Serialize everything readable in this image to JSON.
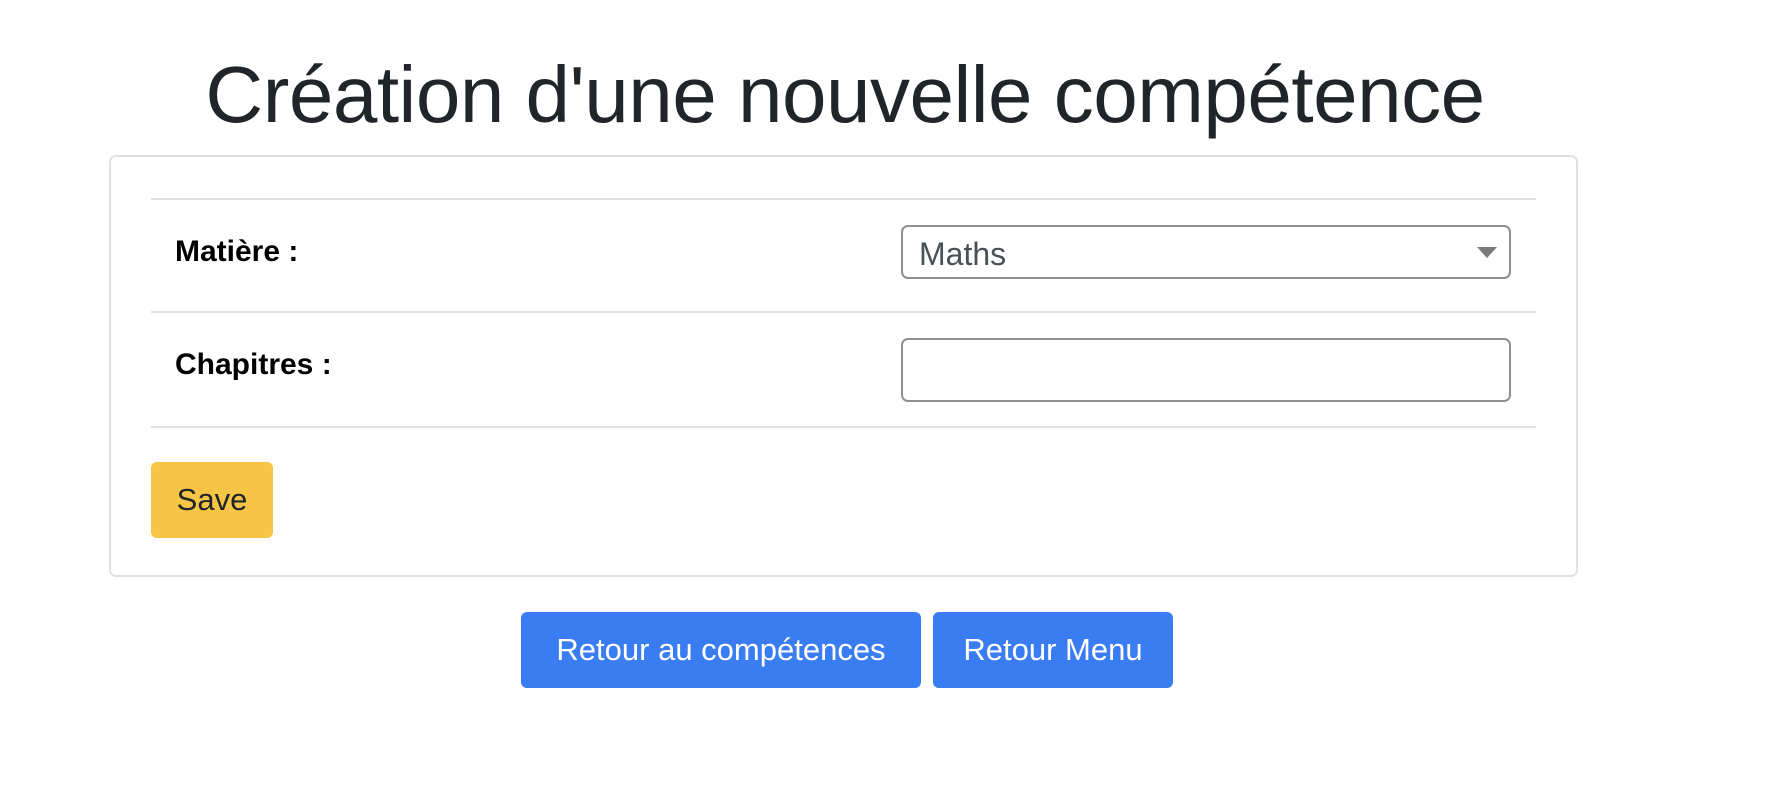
{
  "page": {
    "title": "Création d'une nouvelle compétence"
  },
  "form": {
    "matiere": {
      "label": "Matière :",
      "selected": "Maths"
    },
    "chapitres": {
      "label": "Chapitres :",
      "value": "",
      "placeholder": ""
    },
    "save_label": "Save"
  },
  "nav": {
    "back_competences_label": "Retour au compétences",
    "back_menu_label": "Retour Menu"
  },
  "colors": {
    "save_button": "#f7c545",
    "primary_button": "#3a7cf2",
    "title_text": "#212529"
  }
}
